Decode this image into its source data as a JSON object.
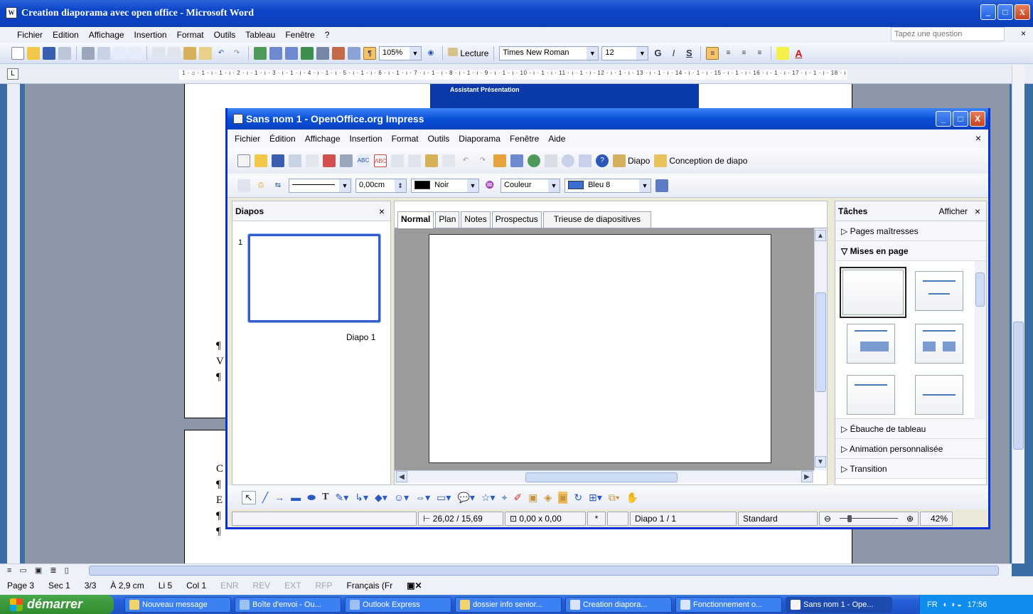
{
  "word": {
    "title": "Creation diaporama avec open office - Microsoft Word",
    "app_icon": "W",
    "window_buttons": [
      "_",
      "□",
      "X"
    ],
    "menu": [
      "Fichier",
      "Edition",
      "Affichage",
      "Insertion",
      "Format",
      "Outils",
      "Tableau",
      "Fenêtre",
      "?"
    ],
    "ask_placeholder": "Tapez une question",
    "menu_close": "×",
    "toolbar": {
      "zoom": "105%",
      "lecture_label": "Lecture",
      "font": "Times New Roman",
      "size": "12",
      "bold": "G",
      "italic": "I",
      "underline": "S",
      "font_color": "A"
    },
    "ruler_corner": "L",
    "ruler_text": "1 · ⌂ · 1 · ı · 1 · ı · 2 · ı · 1 · ı · 3 · ı · 1 · ı · 4 · ı · 1 · ı · 5 · ı · 1 · ı · 6 · ı · 1 · ı · 7 · ı · 1 · ı · 8 · ı · 1 · ı · 9 · ı · 1 · ı · 10 · ı · 1 · ı · 11 · ı · 1 · ı · 12 · ı · 1 · ı · 13 · ı · 1 · ı · 14 · ı · 1 · ı · 15 · ı · 1 · ı · 16 · ı · 1 · ı · 17 · ı · 1 · ı · 18 · ı · 1 · ı · △ · ı ·",
    "doc_marks": {
      "p1": [
        "¶",
        "V",
        "¶"
      ],
      "p2": [
        "C",
        "¶",
        "E",
        "¶",
        "¶"
      ]
    },
    "status": [
      "Page 3",
      "Sec 1",
      "3/3",
      "À 2,9 cm",
      "Li 5",
      "Col 1"
    ],
    "status_dim": [
      "ENR",
      "REV",
      "EXT",
      "RFP"
    ],
    "language": "Français (Fr",
    "behind_dialog_title": "Assistant Présentation"
  },
  "impress": {
    "title": "Sans nom 1 - OpenOffice.org Impress",
    "window_buttons": [
      "_",
      "□",
      "X"
    ],
    "menu": [
      "Fichier",
      "Édition",
      "Affichage",
      "Insertion",
      "Format",
      "Outils",
      "Diaporama",
      "Fenêtre",
      "Aide"
    ],
    "menu_close": "×",
    "toolbar": {
      "diapo_label": "Diapo",
      "conception_label": "Conception de diapo",
      "line_width": "0,00cm",
      "line_color": "Noir",
      "fill_mode": "Couleur",
      "fill_color": "Bleu 8",
      "colors": {
        "noir": "#000000",
        "bleu8": "#3b6fd4"
      }
    },
    "slides_pane": {
      "title": "Diapos",
      "close": "×",
      "slide_number": "1",
      "slide_caption": "Diapo 1"
    },
    "tabs": [
      "Normal",
      "Plan",
      "Notes",
      "Prospectus",
      "Trieuse de diapositives"
    ],
    "tasks": {
      "title": "Tâches",
      "view": "Afficher",
      "close": "×",
      "sections": [
        {
          "label": "Pages maîtresses",
          "open": false
        },
        {
          "label": "Mises en page",
          "open": true
        },
        {
          "label": "Ébauche de tableau",
          "open": false
        },
        {
          "label": "Animation personnalisée",
          "open": false
        },
        {
          "label": "Transition",
          "open": false
        }
      ]
    },
    "status": {
      "position": "26,02 / 15,69",
      "size": "0,00 x 0,00",
      "modified": "*",
      "page": "Diapo 1 / 1",
      "layout": "Standard",
      "zoom": "42%"
    }
  },
  "taskbar": {
    "start_label": "démarrer",
    "items": [
      {
        "label": "Nouveau message",
        "active": false
      },
      {
        "label": "Boîte d'envoi - Ou...",
        "active": false
      },
      {
        "label": "Outlook Express",
        "active": false
      },
      {
        "label": "dossier info senior...",
        "active": false
      },
      {
        "label": "Creation diapora...",
        "active": false
      },
      {
        "label": "Fonctionnement o...",
        "active": false
      },
      {
        "label": "Sans nom 1 - Ope...",
        "active": true
      }
    ],
    "tray_lang": "FR",
    "clock": "17:56"
  }
}
